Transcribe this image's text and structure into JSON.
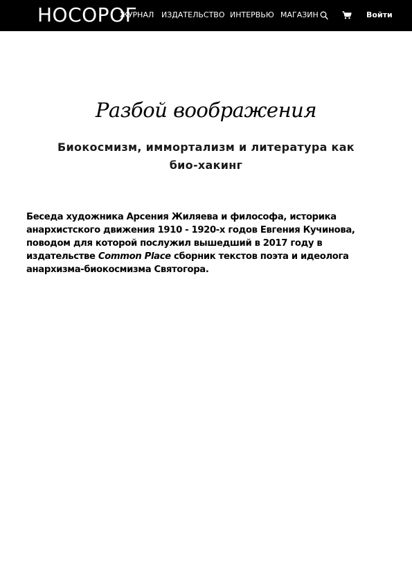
{
  "header": {
    "logo": "НОСОРОГ",
    "nav": {
      "journal": "ЖУРНАЛ",
      "publishing": "ИЗДАТЕЛЬСТВО",
      "interview": "ИНТЕРВЬЮ",
      "shop": "МАГАЗИН"
    },
    "search_icon": "search-icon",
    "cart_icon": "cart-icon",
    "login": "Войти",
    "background": "#000000",
    "text_color": "#ffffff"
  },
  "article": {
    "title": "Разбой воображения",
    "subtitle": "Биокосмизм, иммортализм и литература как био-хакинг",
    "lead": {
      "part1": "Беседа художника Арсения Жиляева и философа, историка анархистского движения 1910 - 1920-х годов Евгения Кучинова, поводом для которой послужил вышедший в 2017 году в издательстве ",
      "italic": "Common Place",
      "part2": " сборник текстов поэта и идеолога анархизма-биокосмизма Святогора."
    }
  }
}
